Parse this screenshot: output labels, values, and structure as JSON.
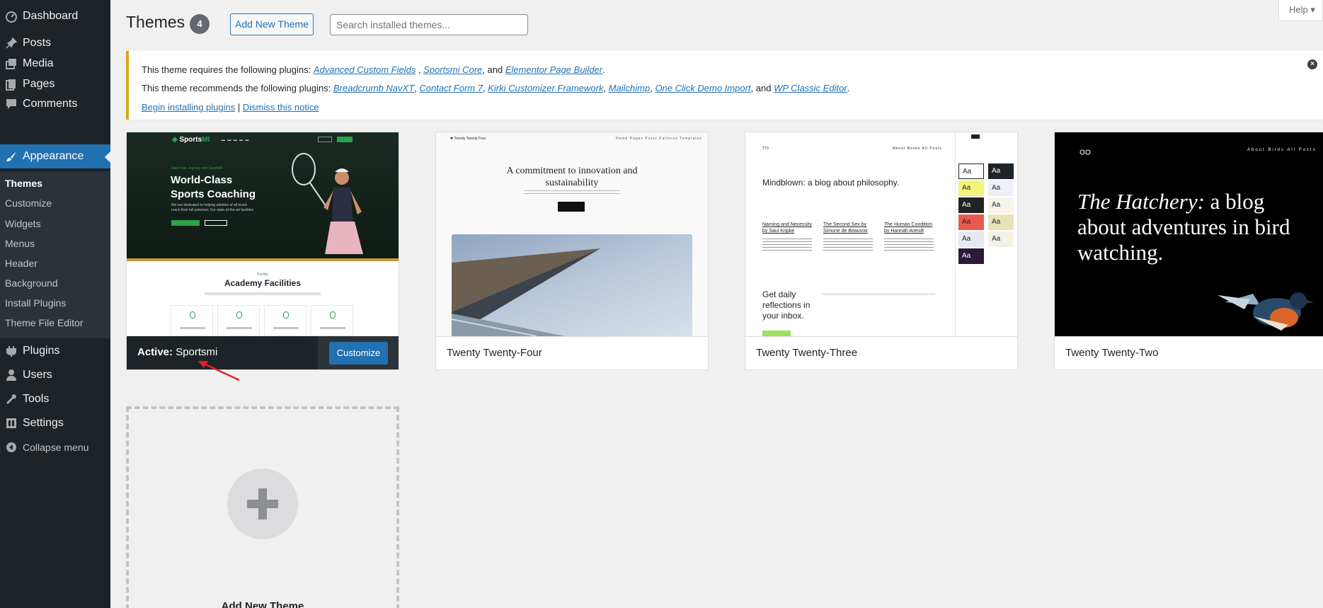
{
  "sidebar": {
    "items": [
      {
        "label": "Dashboard",
        "icon": "dashboard-icon"
      },
      {
        "label": "Posts",
        "icon": "pin-icon"
      },
      {
        "label": "Media",
        "icon": "media-icon"
      },
      {
        "label": "Pages",
        "icon": "pages-icon"
      },
      {
        "label": "Comments",
        "icon": "comment-icon"
      },
      {
        "label": "Appearance",
        "icon": "paintbrush-icon"
      },
      {
        "label": "Plugins",
        "icon": "plugin-icon"
      },
      {
        "label": "Users",
        "icon": "user-icon"
      },
      {
        "label": "Tools",
        "icon": "wrench-icon"
      },
      {
        "label": "Settings",
        "icon": "settings-icon"
      },
      {
        "label": "Collapse menu",
        "icon": "collapse-icon"
      }
    ],
    "submenu": [
      "Themes",
      "Customize",
      "Widgets",
      "Menus",
      "Header",
      "Background",
      "Install Plugins",
      "Theme File Editor"
    ]
  },
  "header": {
    "title": "Themes",
    "count": "4",
    "add_new_label": "Add New Theme",
    "search_placeholder": "Search installed themes...",
    "help_label": "Help ▾"
  },
  "notice": {
    "requires_prefix": "This theme requires the following plugins:",
    "required_plugins": [
      "Advanced Custom Fields",
      "Sportsmi Core",
      "Elementor Page Builder"
    ],
    "recommends_prefix": "This theme recommends the following plugins:",
    "recommended_plugins": [
      "Breadcrumb NavXT",
      "Contact Form 7",
      "Kirki Customizer Framework",
      "Mailchimp",
      "One Click Demo Import",
      "WP Classic Editor"
    ],
    "and": "and",
    "begin_link": "Begin installing plugins",
    "separator": "|",
    "dismiss_link": "Dismiss this notice"
  },
  "themes": {
    "active": {
      "prefix": "Active:",
      "name": "Sportsmi",
      "customize_label": "Customize"
    },
    "twentyfour": {
      "name": "Twenty Twenty-Four"
    },
    "twentythree": {
      "name": "Twenty Twenty-Three"
    },
    "twentytwo": {
      "name": "Twenty Twenty-Two"
    }
  },
  "previews": {
    "sportsmi": {
      "logo_a": "Sports",
      "logo_b": "MI",
      "kicker": "Start Your Journey with SportsMI",
      "title": "World-Class Sports Coaching",
      "desc": "We are dedicated to helping athletes of all levels reach their full potential. Our state-of-the-art facilities",
      "facility_kicker": "Facility",
      "facility_title": "Academy Facilities",
      "boxes": [
        "Sports Course",
        "Expert Trainer",
        "Fitness Center",
        "Swimming Pool"
      ]
    },
    "twentyfour": {
      "site": "Twenty Twenty Four",
      "nav": "Home  Pages  Posts  Patterns  Templates",
      "headline": "A commitment to innovation and sustainability"
    },
    "twentythree": {
      "logo": "TT3",
      "nav": "About  Books  All Posts",
      "headline": "Mindblown: a blog about philosophy.",
      "posts": [
        "Naming and Necessity by Saul Kripke",
        "The Second Sex by Simone de Beauvoir",
        "The Human Condition by Hannah Arendt"
      ],
      "sub": "Get daily reflections in your inbox.",
      "swatch_text": "Aa"
    },
    "twentytwo": {
      "nav": "About  Birds  All Posts",
      "headline_italic": "The Hatchery:",
      "headline_rest": " a blog about adventures in bird watching."
    }
  },
  "add_new_card": {
    "label": "Add New Theme"
  },
  "colors": {
    "accent": "#2271b1",
    "sidebar": "#1d2327",
    "notice_border": "#dba617",
    "annotation_arrow": "#e02424"
  }
}
